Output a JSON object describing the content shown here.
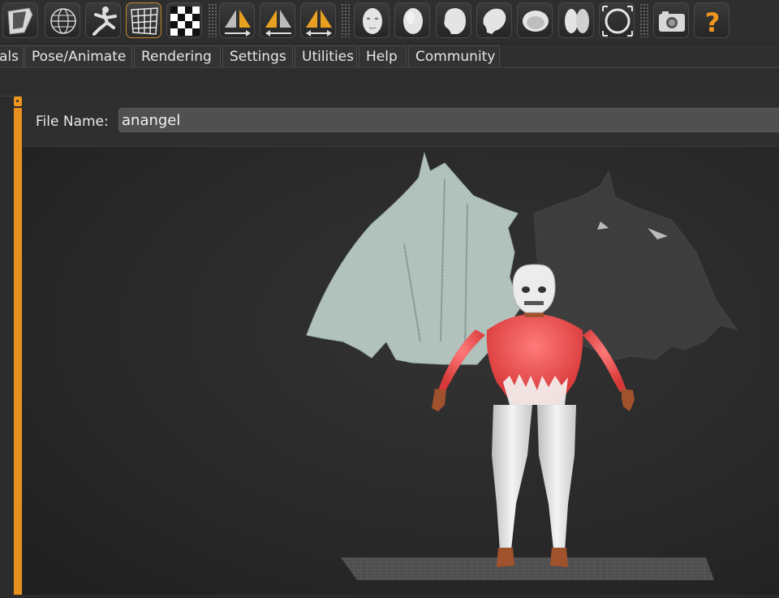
{
  "toolbar": {
    "buttons": [
      {
        "icon": "wing-shape-icon"
      },
      {
        "icon": "wireframe-sphere-icon"
      },
      {
        "icon": "running-figure-icon"
      },
      {
        "icon": "uv-grid-icon",
        "active": true
      },
      {
        "icon": "checkerboard-icon"
      },
      {
        "icon": "mirror-right-icon"
      },
      {
        "icon": "mirror-left-icon"
      },
      {
        "icon": "mirror-both-icon"
      },
      {
        "icon": "face-front-icon"
      },
      {
        "icon": "head-front-icon"
      },
      {
        "icon": "head-three-quarter-icon"
      },
      {
        "icon": "head-profile-icon"
      },
      {
        "icon": "head-tilt-icon"
      },
      {
        "icon": "head-back-icon"
      },
      {
        "icon": "fit-view-icon"
      },
      {
        "icon": "camera-icon"
      },
      {
        "icon": "help-icon"
      }
    ],
    "accent_color": "#f0961e"
  },
  "menu": {
    "items": [
      "als",
      "Pose/Animate",
      "Rendering",
      "Settings",
      "Utilities",
      "Help",
      "Community"
    ]
  },
  "file": {
    "label": "File Name:",
    "value": "anangel"
  }
}
